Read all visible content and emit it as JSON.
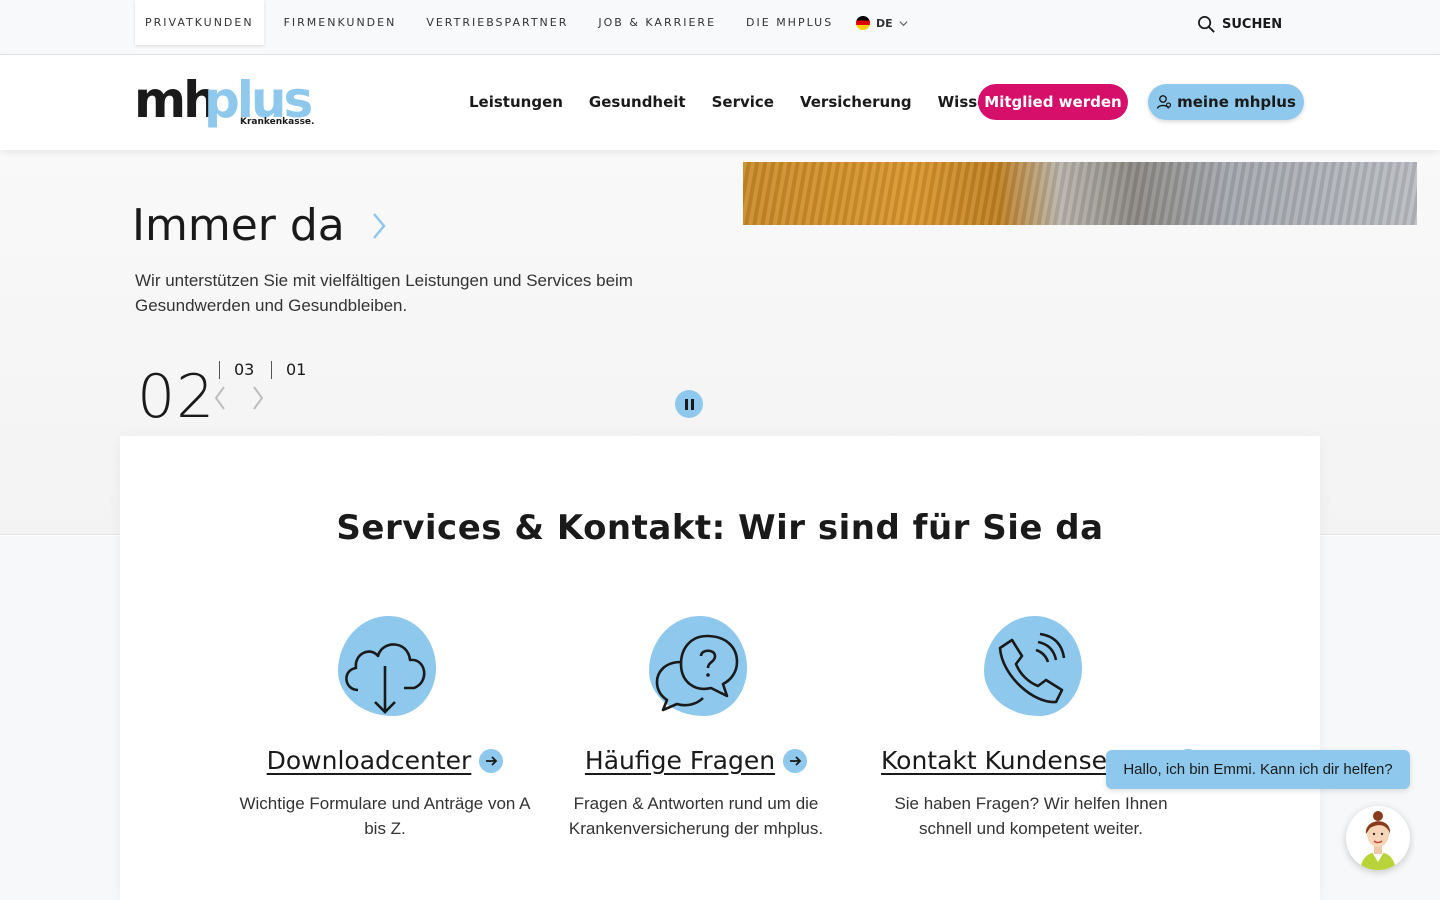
{
  "topnav": {
    "items": [
      {
        "label": "PRIVATKUNDEN"
      },
      {
        "label": "FIRMENKUNDEN"
      },
      {
        "label": "VERTRIEBSPARTNER"
      },
      {
        "label": "JOB & KARRIERE"
      },
      {
        "label": "DIE MHPLUS"
      }
    ],
    "language": "DE",
    "search_label": "SUCHEN"
  },
  "header": {
    "logo": {
      "main": "mh",
      "accent": "plus",
      "sub": "Krankenkasse."
    },
    "nav": [
      {
        "label": "Leistungen"
      },
      {
        "label": "Gesundheit"
      },
      {
        "label": "Service"
      },
      {
        "label": "Versicherung"
      },
      {
        "label": "Wissen"
      }
    ],
    "cta_member": "Mitglied werden",
    "cta_account": "meine mhplus"
  },
  "hero": {
    "title": "Immer da",
    "text": "Wir unterstützen Sie mit vielfältigen Leistungen und Services beim Gesundwerden und Gesundbleiben.",
    "slide_current": "02",
    "slide_next_1": "03",
    "slide_next_2": "01"
  },
  "services": {
    "heading": "Services & Kontakt: Wir sind für Sie da",
    "items": [
      {
        "title": "Downloadcenter ",
        "desc": "Wichtige Formulare und Anträge von A bis Z.",
        "icon": "cloud-download-icon"
      },
      {
        "title": "Häufige Fragen ",
        "desc": "Fragen & Antworten rund um die Krankenversicherung der mhplus.",
        "icon": "chat-question-icon"
      },
      {
        "title": "Kontakt Kundenservice",
        "desc": "Sie haben Fragen? Wir helfen Ihnen schnell und kompetent weiter.",
        "icon": "phone-icon"
      }
    ]
  },
  "chat": {
    "greeting": "Hallo, ich bin Emmi. Kann ich dir helfen?"
  },
  "colors": {
    "accent_blue": "#8ec8ec",
    "brand_pink": "#d60f6b"
  }
}
